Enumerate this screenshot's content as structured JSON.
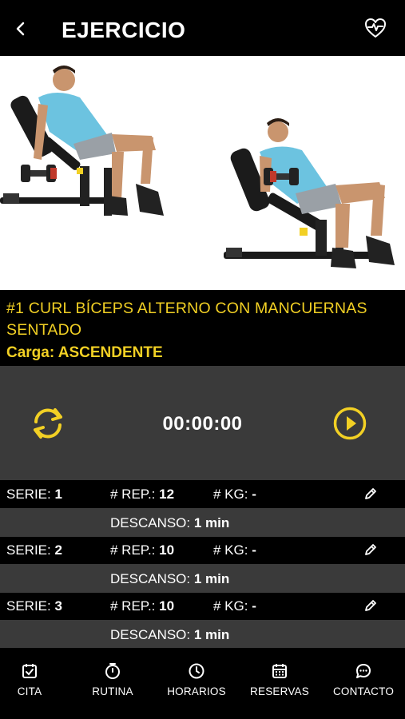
{
  "header": {
    "title": "EJERCICIO"
  },
  "exercise": {
    "name": "#1 CURL BÍCEPS ALTERNO CON MANCUERNAS SENTADO",
    "load_label": "Carga:",
    "load_value": "ASCENDENTE"
  },
  "timer": {
    "value": "00:00:00"
  },
  "labels": {
    "serie": "SERIE:",
    "rep": "# REP.:",
    "kg": "# KG:",
    "rest": "DESCANSO:"
  },
  "series": [
    {
      "number": "1",
      "reps": "12",
      "kg": "-",
      "rest": "1 min"
    },
    {
      "number": "2",
      "reps": "10",
      "kg": "-",
      "rest": "1 min"
    },
    {
      "number": "3",
      "reps": "10",
      "kg": "-",
      "rest": "1 min"
    }
  ],
  "tabs": [
    {
      "label": "CITA",
      "icon": "calendar-check-icon"
    },
    {
      "label": "RUTINA",
      "icon": "stopwatch-icon"
    },
    {
      "label": "HORARIOS",
      "icon": "clock-icon"
    },
    {
      "label": "RESERVAS",
      "icon": "calendar-grid-icon"
    },
    {
      "label": "CONTACTO",
      "icon": "chat-bubble-icon"
    }
  ],
  "colors": {
    "accent": "#f2d024",
    "background": "#000000",
    "panel": "#3a3a3a",
    "shirt": "#6cc3e0"
  }
}
